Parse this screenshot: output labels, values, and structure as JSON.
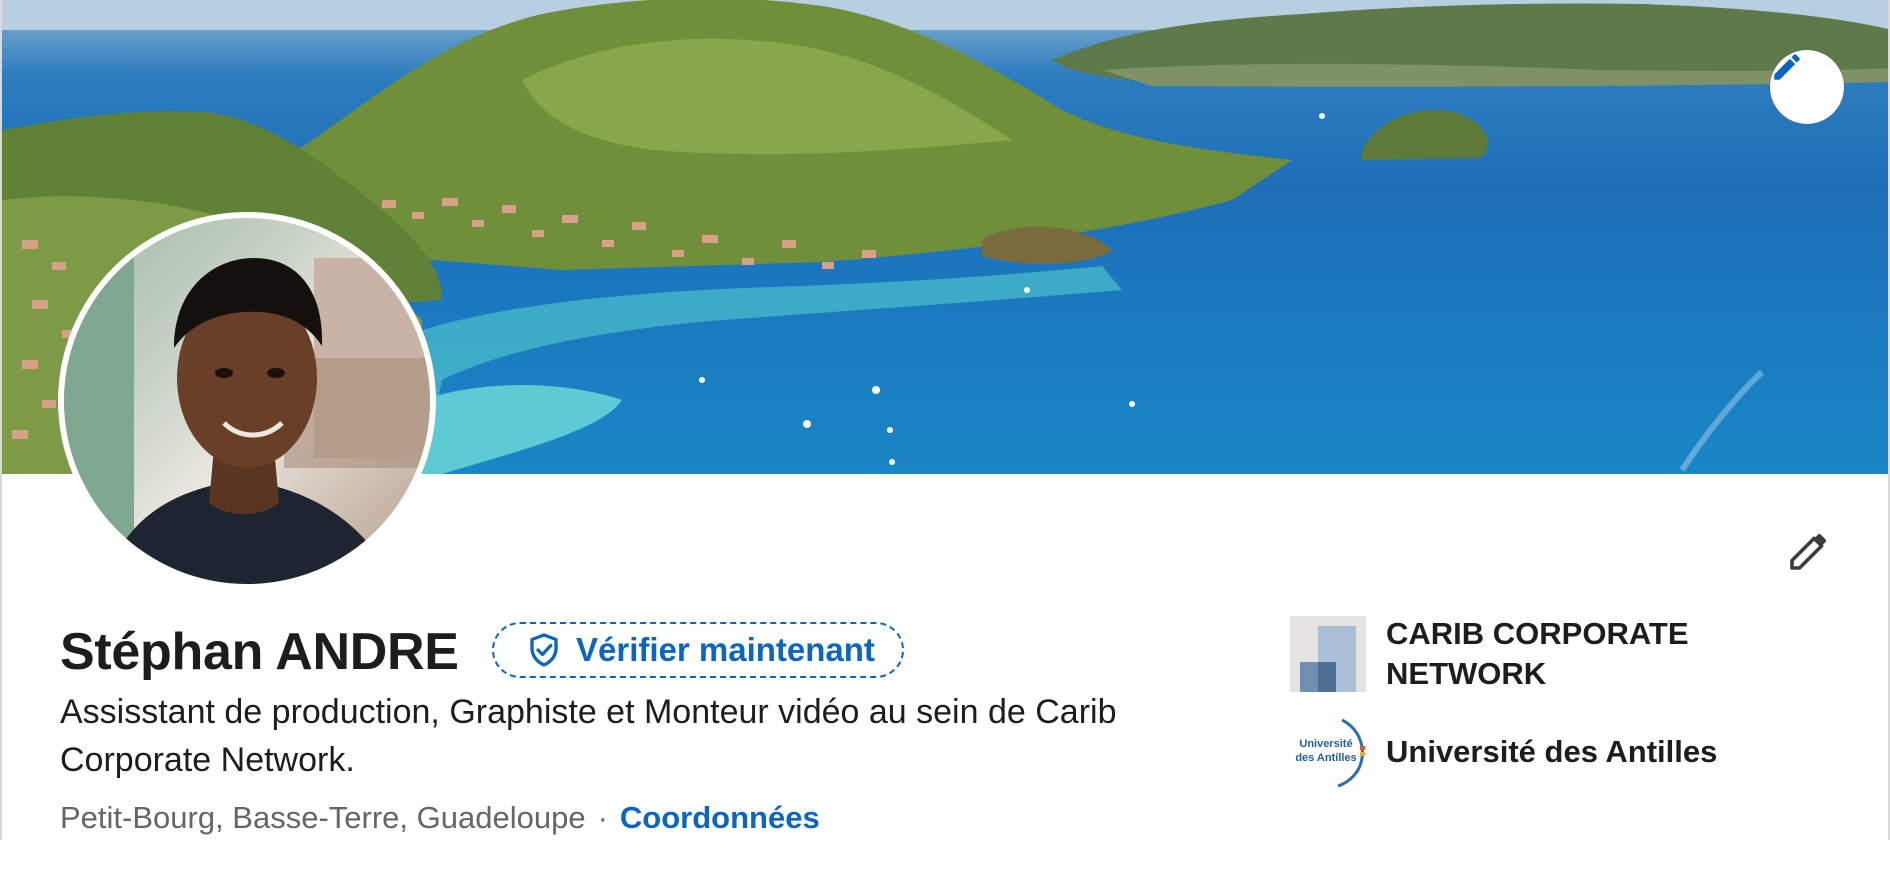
{
  "profile": {
    "name": "Stéphan ANDRE",
    "verify_label": "Vérifier maintenant",
    "headline": "Assisstant de production, Graphiste et Monteur vidéo au sein de Carib Corporate Network.",
    "location": "Petit-Bourg, Basse-Terre, Guadeloupe",
    "separator": "·",
    "contact_label": "Coordonnées"
  },
  "organizations": [
    {
      "name": "CARIB CORPORATE NETWORK",
      "logo": "company-logo"
    },
    {
      "name": "Université des Antilles",
      "logo": "university-logo",
      "logo_text_1": "Université",
      "logo_text_2": "des Antilles"
    }
  ],
  "icons": {
    "cover_edit": "pencil-icon",
    "intro_edit": "pencil-icon",
    "verify": "shield-check-icon"
  },
  "colors": {
    "accent": "#0a66c2",
    "text": "#1d1d1d",
    "muted": "#666666"
  }
}
